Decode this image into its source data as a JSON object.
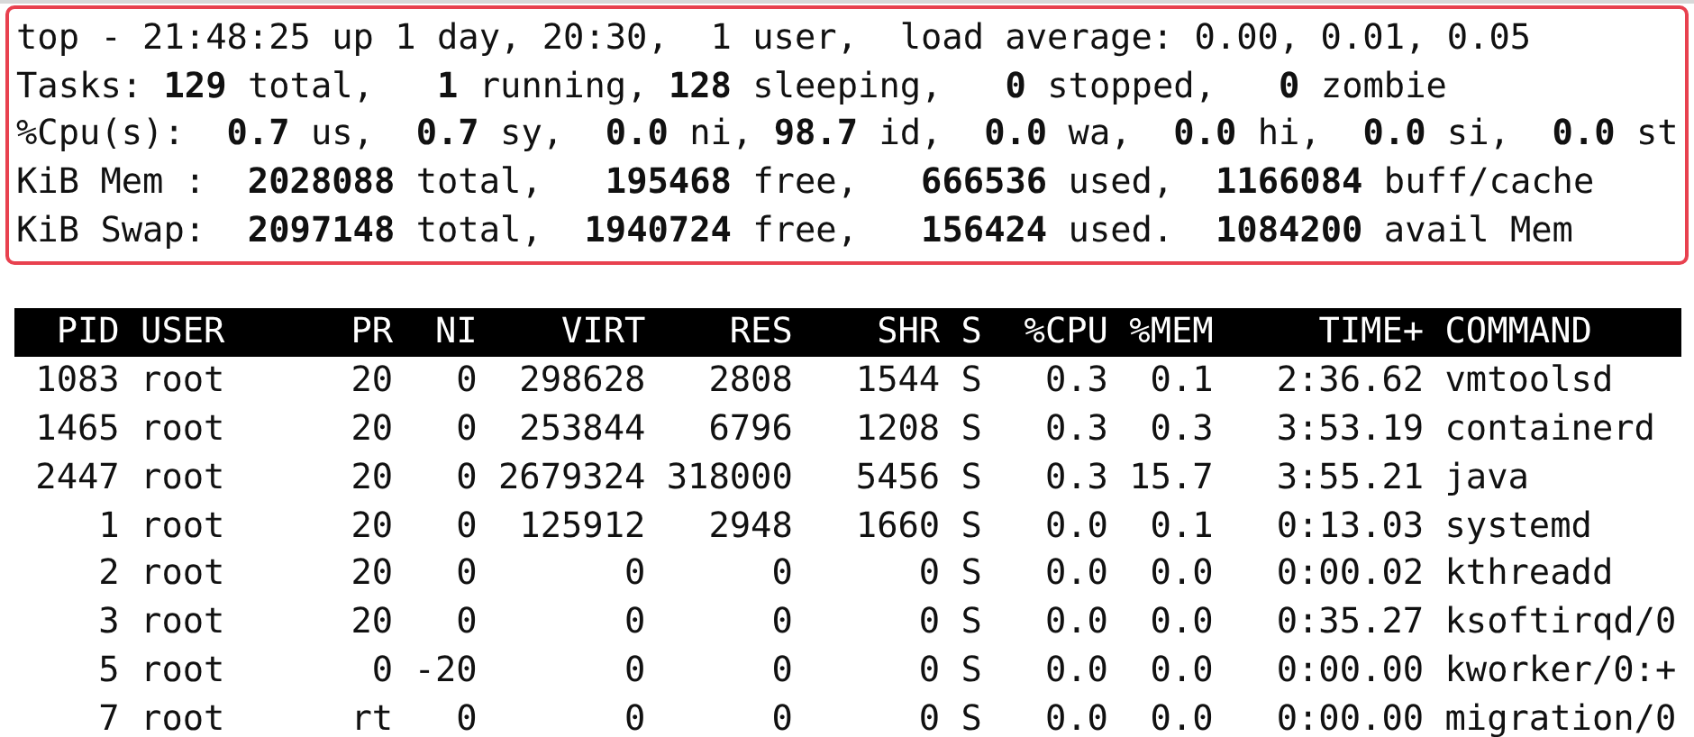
{
  "summary_lines": [
    "top - 21:48:25 up 1 day, 20:30,  1 user,  load average: 0.00, 0.01, 0.05",
    "Tasks: **129** total,   **1** running, **128** sleeping,   **0** stopped,   **0** zombie",
    "%Cpu(s):  **0.7** us,  **0.7** sy,  **0.0** ni, **98.7** id,  **0.0** wa,  **0.0** hi,  **0.0** si,  **0.0** st",
    "KiB Mem :  **2028088** total,   **195468** free,   **666536** used,  **1166084** buff/cache",
    "KiB Swap:  **2097148** total,  **1940724** free,   **156424** used.  **1084200** avail Mem"
  ],
  "table": {
    "columns": [
      "PID",
      "USER",
      "PR",
      "NI",
      "VIRT",
      "RES",
      "SHR",
      "S",
      "%CPU",
      "%MEM",
      "TIME+",
      "COMMAND"
    ],
    "rows": [
      [
        "1083",
        "root",
        "20",
        "0",
        "298628",
        "2808",
        "1544",
        "S",
        "0.3",
        "0.1",
        "2:36.62",
        "vmtoolsd"
      ],
      [
        "1465",
        "root",
        "20",
        "0",
        "253844",
        "6796",
        "1208",
        "S",
        "0.3",
        "0.3",
        "3:53.19",
        "containerd"
      ],
      [
        "2447",
        "root",
        "20",
        "0",
        "2679324",
        "318000",
        "5456",
        "S",
        "0.3",
        "15.7",
        "3:55.21",
        "java"
      ],
      [
        "1",
        "root",
        "20",
        "0",
        "125912",
        "2948",
        "1660",
        "S",
        "0.0",
        "0.1",
        "0:13.03",
        "systemd"
      ],
      [
        "2",
        "root",
        "20",
        "0",
        "0",
        "0",
        "0",
        "S",
        "0.0",
        "0.0",
        "0:00.02",
        "kthreadd"
      ],
      [
        "3",
        "root",
        "20",
        "0",
        "0",
        "0",
        "0",
        "S",
        "0.0",
        "0.0",
        "0:35.27",
        "ksoftirqd/0"
      ],
      [
        "5",
        "root",
        "0",
        "-20",
        "0",
        "0",
        "0",
        "S",
        "0.0",
        "0.0",
        "0:00.00",
        "kworker/0:+"
      ],
      [
        "7",
        "root",
        "rt",
        "0",
        "0",
        "0",
        "0",
        "S",
        "0.0",
        "0.0",
        "0:00.00",
        "migration/0"
      ]
    ]
  }
}
